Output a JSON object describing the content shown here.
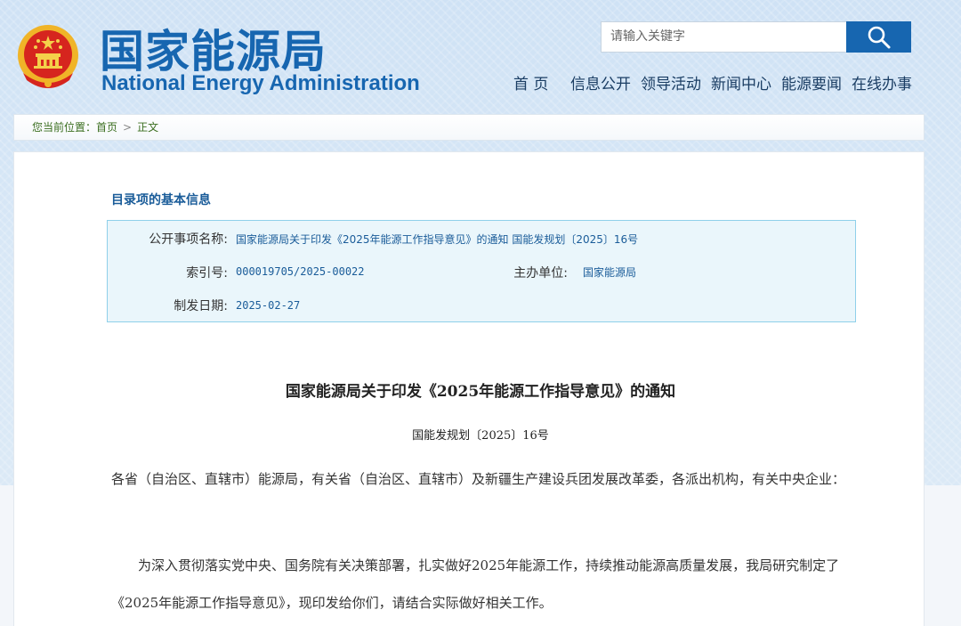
{
  "header": {
    "logo_cn": "国家能源局",
    "logo_en": "National Energy Administration",
    "search_placeholder": "请输入关键字"
  },
  "nav": [
    {
      "label": "首 页"
    },
    {
      "label": "信息公开"
    },
    {
      "label": "领导活动"
    },
    {
      "label": "新闻中心"
    },
    {
      "label": "能源要闻"
    },
    {
      "label": "在线办事"
    }
  ],
  "breadcrumb": {
    "prefix": "您当前位置：",
    "home": "首页",
    "separator": ">",
    "current": "正文"
  },
  "info": {
    "title": "目录项的基本信息",
    "fields": {
      "name_label": "公开事项名称:",
      "name_value": "国家能源局关于印发《2025年能源工作指导意见》的通知 国能发规划〔2025〕16号",
      "index_label": "索引号:",
      "index_value": "000019705/2025-00022",
      "issuer_label": "主办单位:",
      "issuer_value": "国家能源局",
      "date_label": "制发日期:",
      "date_value": "2025-02-27"
    }
  },
  "document": {
    "title": "国家能源局关于印发《2025年能源工作指导意见》的通知",
    "number": "国能发规划〔2025〕16号",
    "paragraphs": [
      "各省（自治区、直辖市）能源局，有关省（自治区、直辖市）及新疆生产建设兵团发展改革委，各派出机构，有关中央企业：",
      "为深入贯彻落实党中央、国务院有关决策部署，扎实做好2025年能源工作，持续推动能源高质量发展，我局研究制定了《2025年能源工作指导意见》，现印发给你们，请结合实际做好相关工作。"
    ]
  },
  "colors": {
    "brand_blue": "#1766b0",
    "info_bg": "#eaf6fb",
    "info_border": "#8fd0ea",
    "breadcrumb_green": "#3a6e1f"
  }
}
